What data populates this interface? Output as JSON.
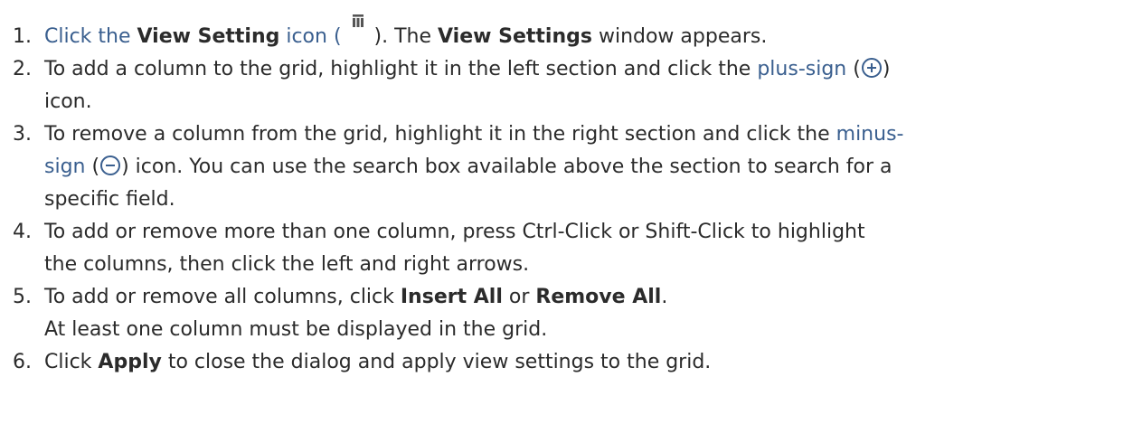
{
  "steps": [
    {
      "number": "1.",
      "text": {
        "click_the": "Click the ",
        "view_setting": "View Setting",
        "icon_open": " icon (",
        "close_paren": ").",
        "the": " The ",
        "view_settings": "View Settings",
        "window_appears": " window appears."
      }
    },
    {
      "number": "2.",
      "text": {
        "intro": "To add a column to the grid, highlight it in the left section and click the ",
        "plus_sign": "plus-sign",
        "open_paren": " (",
        "close_paren": ")",
        "icon": "icon."
      }
    },
    {
      "number": "3.",
      "text": {
        "intro": "To remove a column from the grid, highlight it in the right section and click the ",
        "minus_1": "minus-",
        "minus_2": "sign",
        "open_paren": " (",
        "rest": ") icon. You can use the search box available above the section to search for a",
        "line3": "specific field."
      }
    },
    {
      "number": "4.",
      "text": {
        "line1": "To add or remove more than one column, press Ctrl-Click or Shift-Click to highlight",
        "line2": "the columns, then click the left and right arrows."
      }
    },
    {
      "number": "5.",
      "text": {
        "intro": "To add or remove all columns, click ",
        "insert_all": "Insert All",
        "or": " or ",
        "remove_all": "Remove All",
        "period": ".",
        "note": "At least one column must be displayed in the grid."
      }
    },
    {
      "number": "6.",
      "text": {
        "click": "Click ",
        "apply": "Apply",
        "rest": " to close the dialog and apply view settings to the grid."
      }
    }
  ],
  "icons": {
    "view_setting_icon": "view-columns-icon",
    "plus_icon": "plus-circle-icon",
    "minus_icon": "minus-circle-icon"
  },
  "colors": {
    "link": "#3a5f8f",
    "text": "#2b2b2b",
    "icon_fill": "#555555"
  }
}
